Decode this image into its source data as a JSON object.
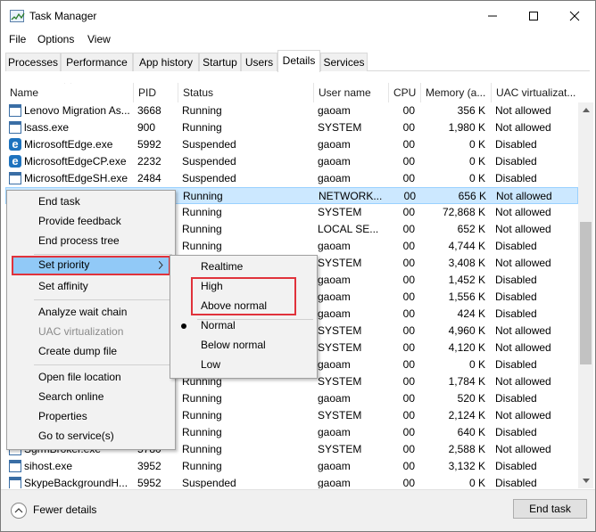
{
  "window": {
    "title": "Task Manager"
  },
  "menubar": [
    "File",
    "Options",
    "View"
  ],
  "tabs": [
    "Processes",
    "Performance",
    "App history",
    "Startup",
    "Users",
    "Details",
    "Services"
  ],
  "active_tab": "Details",
  "columns": [
    "Name",
    "PID",
    "Status",
    "User name",
    "CPU",
    "Memory (a...",
    "UAC virtualizat..."
  ],
  "rows": [
    {
      "icon": "window-icon",
      "name": "Lenovo Migration As...",
      "pid": "3668",
      "status": "Running",
      "user": "gaoam",
      "cpu": "00",
      "mem": "356 K",
      "uac": "Not allowed"
    },
    {
      "icon": "window-icon",
      "name": "lsass.exe",
      "pid": "900",
      "status": "Running",
      "user": "SYSTEM",
      "cpu": "00",
      "mem": "1,980 K",
      "uac": "Not allowed"
    },
    {
      "icon": "edge-icon",
      "name": "MicrosoftEdge.exe",
      "pid": "5992",
      "status": "Suspended",
      "user": "gaoam",
      "cpu": "00",
      "mem": "0 K",
      "uac": "Disabled"
    },
    {
      "icon": "edge-icon",
      "name": "MicrosoftEdgeCP.exe",
      "pid": "2232",
      "status": "Suspended",
      "user": "gaoam",
      "cpu": "00",
      "mem": "0 K",
      "uac": "Disabled"
    },
    {
      "icon": "window-icon",
      "name": "MicrosoftEdgeSH.exe",
      "pid": "2484",
      "status": "Suspended",
      "user": "gaoam",
      "cpu": "00",
      "mem": "0 K",
      "uac": "Disabled"
    },
    {
      "icon": "",
      "name": "",
      "pid": "",
      "status": "Running",
      "user": "NETWORK...",
      "cpu": "00",
      "mem": "656 K",
      "uac": "Not allowed"
    },
    {
      "icon": "",
      "name": "",
      "pid": "",
      "status": "Running",
      "user": "SYSTEM",
      "cpu": "00",
      "mem": "72,868 K",
      "uac": "Not allowed"
    },
    {
      "icon": "",
      "name": "",
      "pid": "",
      "status": "Running",
      "user": "LOCAL SE...",
      "cpu": "00",
      "mem": "652 K",
      "uac": "Not allowed"
    },
    {
      "icon": "",
      "name": "",
      "pid": "",
      "status": "Running",
      "user": "gaoam",
      "cpu": "00",
      "mem": "4,744 K",
      "uac": "Disabled"
    },
    {
      "icon": "",
      "name": "",
      "pid": "",
      "status": "",
      "user": "SYSTEM",
      "cpu": "00",
      "mem": "3,408 K",
      "uac": "Not allowed"
    },
    {
      "icon": "",
      "name": "",
      "pid": "",
      "status": "",
      "user": "gaoam",
      "cpu": "00",
      "mem": "1,452 K",
      "uac": "Disabled"
    },
    {
      "icon": "",
      "name": "",
      "pid": "",
      "status": "",
      "user": "gaoam",
      "cpu": "00",
      "mem": "1,556 K",
      "uac": "Disabled"
    },
    {
      "icon": "",
      "name": "",
      "pid": "",
      "status": "",
      "user": "gaoam",
      "cpu": "00",
      "mem": "424 K",
      "uac": "Disabled"
    },
    {
      "icon": "",
      "name": "",
      "pid": "",
      "status": "",
      "user": "SYSTEM",
      "cpu": "00",
      "mem": "4,960 K",
      "uac": "Not allowed"
    },
    {
      "icon": "",
      "name": "",
      "pid": "",
      "status": "",
      "user": "SYSTEM",
      "cpu": "00",
      "mem": "4,120 K",
      "uac": "Not allowed"
    },
    {
      "icon": "",
      "name": "",
      "pid": "",
      "status": "",
      "user": "gaoam",
      "cpu": "00",
      "mem": "0 K",
      "uac": "Disabled"
    },
    {
      "icon": "",
      "name": "",
      "pid": "",
      "status": "Running",
      "user": "SYSTEM",
      "cpu": "00",
      "mem": "1,784 K",
      "uac": "Not allowed"
    },
    {
      "icon": "",
      "name": "",
      "pid": "",
      "status": "Running",
      "user": "gaoam",
      "cpu": "00",
      "mem": "520 K",
      "uac": "Disabled"
    },
    {
      "icon": "",
      "name": "",
      "pid": "",
      "status": "Running",
      "user": "SYSTEM",
      "cpu": "00",
      "mem": "2,124 K",
      "uac": "Not allowed"
    },
    {
      "icon": "",
      "name": "",
      "pid": "",
      "status": "Running",
      "user": "gaoam",
      "cpu": "00",
      "mem": "640 K",
      "uac": "Disabled"
    },
    {
      "icon": "window-icon",
      "name": "SgrmBroker.exe",
      "pid": "5780",
      "status": "Running",
      "user": "SYSTEM",
      "cpu": "00",
      "mem": "2,588 K",
      "uac": "Not allowed"
    },
    {
      "icon": "window-icon",
      "name": "sihost.exe",
      "pid": "3952",
      "status": "Running",
      "user": "gaoam",
      "cpu": "00",
      "mem": "3,132 K",
      "uac": "Disabled"
    },
    {
      "icon": "window-icon",
      "name": "SkypeBackgroundH...",
      "pid": "5952",
      "status": "Suspended",
      "user": "gaoam",
      "cpu": "00",
      "mem": "0 K",
      "uac": "Disabled"
    }
  ],
  "selected_row": 5,
  "context_menu": {
    "items": [
      "End task",
      "Provide feedback",
      "End process tree",
      "Set priority",
      "Set affinity",
      "Analyze wait chain",
      "UAC virtualization",
      "Create dump file",
      "Open file location",
      "Search online",
      "Properties",
      "Go to service(s)"
    ],
    "highlighted": "Set priority",
    "disabled": [
      "UAC virtualization"
    ]
  },
  "priority_submenu": {
    "items": [
      "Realtime",
      "High",
      "Above normal",
      "Normal",
      "Below normal",
      "Low"
    ],
    "checked": "Normal"
  },
  "footer": {
    "fewer_details": "Fewer details",
    "end_task": "End task"
  },
  "colors": {
    "selection": "#cce8ff",
    "highlight_box": "#e0323b",
    "menu_hover": "#91c9f7"
  }
}
